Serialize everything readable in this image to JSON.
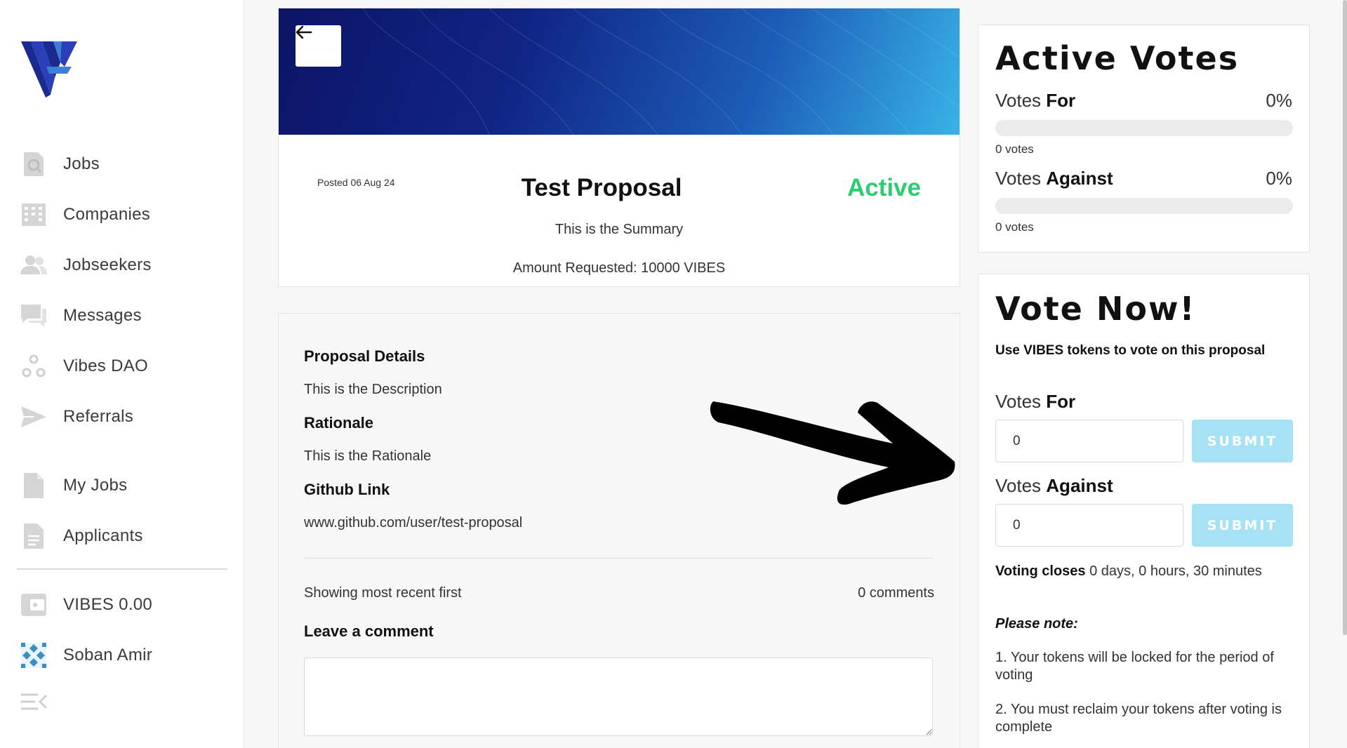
{
  "sidebar": {
    "items": [
      {
        "label": "Jobs",
        "icon": "search-file-icon"
      },
      {
        "label": "Companies",
        "icon": "building-icon"
      },
      {
        "label": "Jobseekers",
        "icon": "users-icon"
      },
      {
        "label": "Messages",
        "icon": "chat-icon"
      },
      {
        "label": "Vibes DAO",
        "icon": "dao-icon"
      },
      {
        "label": "Referrals",
        "icon": "send-icon"
      },
      {
        "label": "My Jobs",
        "icon": "file-icon"
      },
      {
        "label": "Applicants",
        "icon": "document-icon"
      },
      {
        "label": "VIBES 0.00",
        "icon": "wallet-icon"
      },
      {
        "label": "Soban Amir",
        "icon": "avatar"
      }
    ]
  },
  "proposal": {
    "posted": "Posted 06 Aug 24",
    "title": "Test Proposal",
    "status": "Active",
    "summary": "This is the Summary",
    "amount": "Amount Requested: 10000 VIBES",
    "details_heading": "Proposal Details",
    "description": "This is the Description",
    "rationale_heading": "Rationale",
    "rationale": "This is the Rationale",
    "github_heading": "Github Link",
    "github": "www.github.com/user/test-proposal"
  },
  "comments": {
    "sort_text": "Showing most recent first",
    "count": "0 comments",
    "leave_heading": "Leave a comment"
  },
  "active_votes": {
    "title": "Active Votes",
    "for_prefix": "Votes ",
    "for_word": "For",
    "for_pct": "0%",
    "for_votes": "0 votes",
    "for_fraction": 0,
    "against_prefix": "Votes ",
    "against_word": "Against",
    "against_pct": "0%",
    "against_votes": "0 votes",
    "against_fraction": 0
  },
  "vote_now": {
    "title": "Vote Now!",
    "subtitle": "Use VIBES tokens to vote on this proposal",
    "for_prefix": "Votes ",
    "for_word": "For",
    "for_value": "0",
    "against_prefix": "Votes ",
    "against_word": "Against",
    "against_value": "0",
    "submit_label": "SUBMIT",
    "closes_label": "Voting closes",
    "closes_value": " 0 days, 0 hours, 30 minutes",
    "note_heading": "Please note:",
    "note_1": "1. Your tokens will be locked for the period of voting",
    "note_2": "2. You must reclaim your tokens after voting is complete"
  },
  "colors": {
    "active_green": "#2ecc71",
    "submit_disabled": "#a6e1f4",
    "banner_start": "#0c1466",
    "banner_end": "#38b3e6"
  }
}
